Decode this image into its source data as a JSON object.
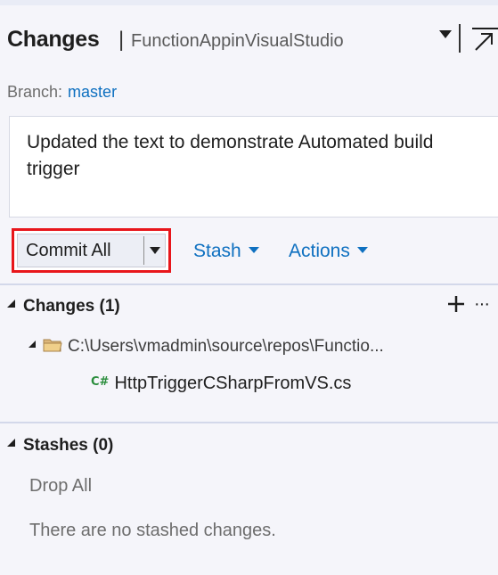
{
  "header": {
    "title": "Changes",
    "separator": "|",
    "repo_name": "FunctionAppinVisualStudio"
  },
  "branch": {
    "label": "Branch:",
    "value": "master"
  },
  "commit_message": {
    "value": "Updated the text to demonstrate Automated build trigger"
  },
  "toolbar": {
    "commit_all_label": "Commit All",
    "stash_label": "Stash",
    "actions_label": "Actions"
  },
  "changes_section": {
    "title": "Changes (1)",
    "more_label": "···",
    "folder_path": "C:\\Users\\vmadmin\\source\\repos\\Functio...",
    "files": [
      {
        "icon_text": "C#",
        "name": "HttpTriggerCSharpFromVS.cs"
      }
    ]
  },
  "stashes_section": {
    "title": "Stashes (0)",
    "drop_all_label": "Drop All",
    "empty_message": "There are no stashed changes."
  },
  "colors": {
    "accent_link": "#0e70c0",
    "highlight_border": "#e8161b",
    "csharp_icon": "#2a8d3c",
    "background": "#f5f5fa"
  }
}
